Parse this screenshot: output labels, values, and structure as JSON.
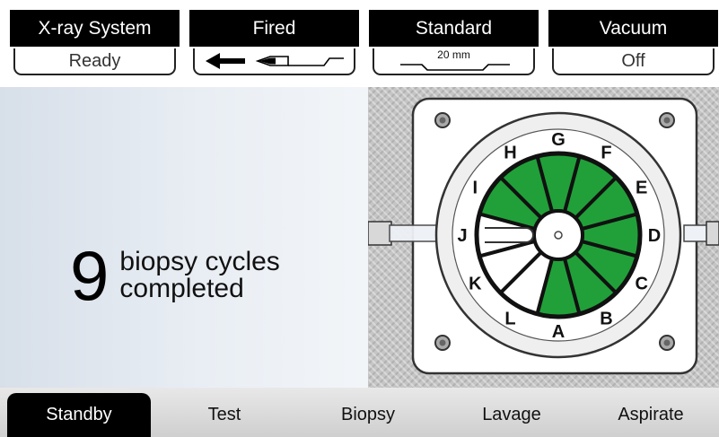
{
  "status_panels": [
    {
      "title": "X-ray System",
      "value": "Ready"
    },
    {
      "title": "Fired",
      "value": ""
    },
    {
      "title": "Standard",
      "value": "20 mm"
    },
    {
      "title": "Vacuum",
      "value": "Off"
    }
  ],
  "message": {
    "count": "9",
    "line1": "biopsy cycles",
    "line2": "completed"
  },
  "sample_wheel": {
    "chamber_labels": [
      "A",
      "B",
      "C",
      "D",
      "E",
      "F",
      "G",
      "H",
      "I",
      "J",
      "K",
      "L"
    ],
    "filled_color": "#21a039",
    "empty_color": "#ffffff",
    "completed_chambers": [
      "A",
      "B",
      "C",
      "D",
      "E",
      "F",
      "G",
      "H",
      "I"
    ],
    "active_chamber": "J"
  },
  "tabs": [
    {
      "label": "Standby",
      "active": true
    },
    {
      "label": "Test",
      "active": false
    },
    {
      "label": "Biopsy",
      "active": false
    },
    {
      "label": "Lavage",
      "active": false
    },
    {
      "label": "Aspirate",
      "active": false
    }
  ]
}
